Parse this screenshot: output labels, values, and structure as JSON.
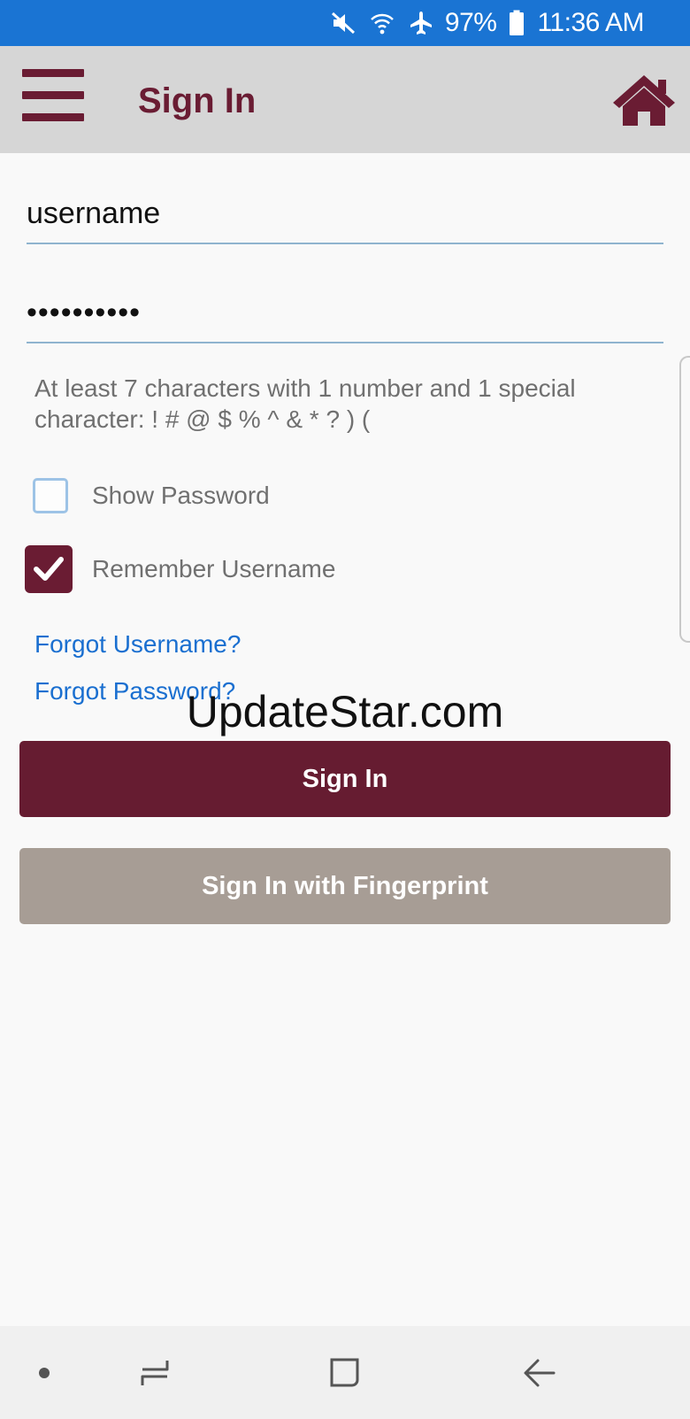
{
  "status_bar": {
    "battery": "97%",
    "time": "11:36 AM",
    "icons": [
      "mute-icon",
      "wifi-icon",
      "airplane-mode-icon",
      "battery-icon"
    ]
  },
  "app_bar": {
    "title": "Sign In",
    "menu_icon": "hamburger-menu-icon",
    "home_icon": "home-icon",
    "accent_color": "#6a1c33",
    "background": "#d6d6d6"
  },
  "form": {
    "username_value": "username",
    "password_value": "••••••••••",
    "password_hint": "At least 7 characters with 1 number and 1 special character: ! # @ $ % ^ & * ? ) (",
    "show_password": {
      "label": "Show Password",
      "checked": false
    },
    "remember_username": {
      "label": "Remember Username",
      "checked": true
    },
    "forgot_username": "Forgot Username?",
    "forgot_password": "Forgot Password?",
    "sign_in": "Sign In",
    "sign_in_fingerprint": "Sign In with Fingerprint",
    "primary_color": "#661c31",
    "secondary_color": "#a79d95",
    "link_color": "#1a6fd0"
  },
  "watermark": "UpdateStar.com",
  "nav_bar": {
    "items": [
      "nav-dot-icon",
      "recent-apps-icon",
      "home-square-icon",
      "back-icon"
    ]
  }
}
